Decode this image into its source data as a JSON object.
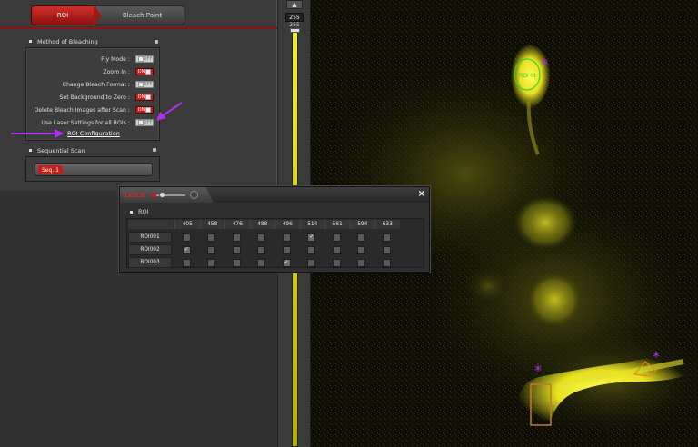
{
  "steps": {
    "roi_label": "ROI",
    "bleach_point_label": "Bleach Point"
  },
  "bleaching": {
    "section_title": "Method of Bleaching",
    "options": [
      {
        "label": "Fly Mode :",
        "state": "OFF"
      },
      {
        "label": "Zoom In :",
        "state": "ON"
      },
      {
        "label": "Change Bleach Format :",
        "state": "OFF"
      },
      {
        "label": "Set Background to Zero :",
        "state": "ON"
      },
      {
        "label": "Delete Bleach Images after Scan :",
        "state": "ON"
      },
      {
        "label": "Use Laser Settings for all ROIs :",
        "state": "OFF"
      }
    ],
    "roi_config_label": "ROI Configuration"
  },
  "sequential": {
    "section_title": "Sequential Scan",
    "seq_chip": "Seq. 1"
  },
  "lut_slider": {
    "max_value": "255",
    "max_value_label": "255"
  },
  "roi_window": {
    "brand": "Leica",
    "close_glyph": "×",
    "section_title": "ROI",
    "columns": [
      "405",
      "458",
      "476",
      "488",
      "496",
      "514",
      "561",
      "594",
      "633"
    ],
    "rows": [
      {
        "name": "ROI001",
        "checked": [
          false,
          false,
          false,
          false,
          false,
          true,
          false,
          false,
          false
        ]
      },
      {
        "name": "ROI002",
        "checked": [
          true,
          false,
          false,
          false,
          false,
          false,
          false,
          false,
          false
        ]
      },
      {
        "name": "ROI003",
        "checked": [
          false,
          false,
          false,
          false,
          true,
          false,
          false,
          false,
          false
        ]
      }
    ]
  },
  "image": {
    "roi_overlay_label": "ROI 01"
  },
  "colors": {
    "accent_red": "#c0201d",
    "annotation_purple": "#b12ff0",
    "roi_green": "#3ecf2e",
    "roi_orange": "#e08a1c",
    "fluor_yellow": "#f2f02a"
  }
}
